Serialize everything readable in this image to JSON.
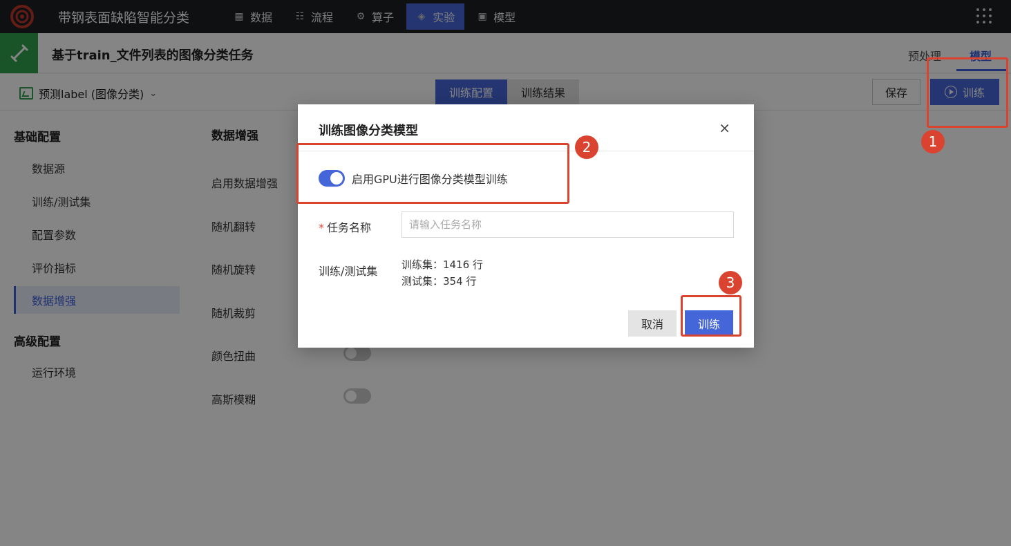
{
  "topnav": {
    "app_title": "带钢表面缺陷智能分类",
    "items": [
      {
        "label": "数据",
        "icon": "grid-icon",
        "active": false
      },
      {
        "label": "流程",
        "icon": "flow-icon",
        "active": false
      },
      {
        "label": "算子",
        "icon": "gear-icon",
        "active": false
      },
      {
        "label": "实验",
        "icon": "cube-icon",
        "active": true
      },
      {
        "label": "模型",
        "icon": "save-icon",
        "active": false
      }
    ]
  },
  "task": {
    "title": "基于train_文件列表的图像分类任务",
    "tabs": [
      "预处理",
      "模型"
    ]
  },
  "toolbar": {
    "predict_label": "预测label (图像分类)",
    "seg_tabs": [
      "训练配置",
      "训练结果"
    ],
    "save_label": "保存",
    "train_label": "训练"
  },
  "sidebar": {
    "group1": "基础配置",
    "items1": [
      "数据源",
      "训练/测试集",
      "配置参数",
      "评价指标",
      "数据增强"
    ],
    "group2": "高级配置",
    "items2": [
      "运行环境"
    ]
  },
  "content": {
    "section_title": "数据增强",
    "fields": [
      "启用数据增强",
      "随机翻转",
      "随机旋转",
      "随机裁剪",
      "颜色扭曲",
      "高斯模糊"
    ]
  },
  "modal": {
    "title": "训练图像分类模型",
    "close": "×",
    "gpu_label": "启用GPU进行图像分类模型训练",
    "gpu_enabled": true,
    "task_name_label": "任务名称",
    "task_name_placeholder": "请输入任务名称",
    "split_label": "训练/测试集",
    "train_set": "训练集：1416 行",
    "test_set": "测试集：354 行",
    "cancel_label": "取消",
    "train_label": "训练"
  },
  "callouts": [
    "1",
    "2",
    "3"
  ],
  "colors": {
    "primary": "#4566d8",
    "accent_green": "#2ea24b",
    "callout_red": "#d9432f"
  }
}
